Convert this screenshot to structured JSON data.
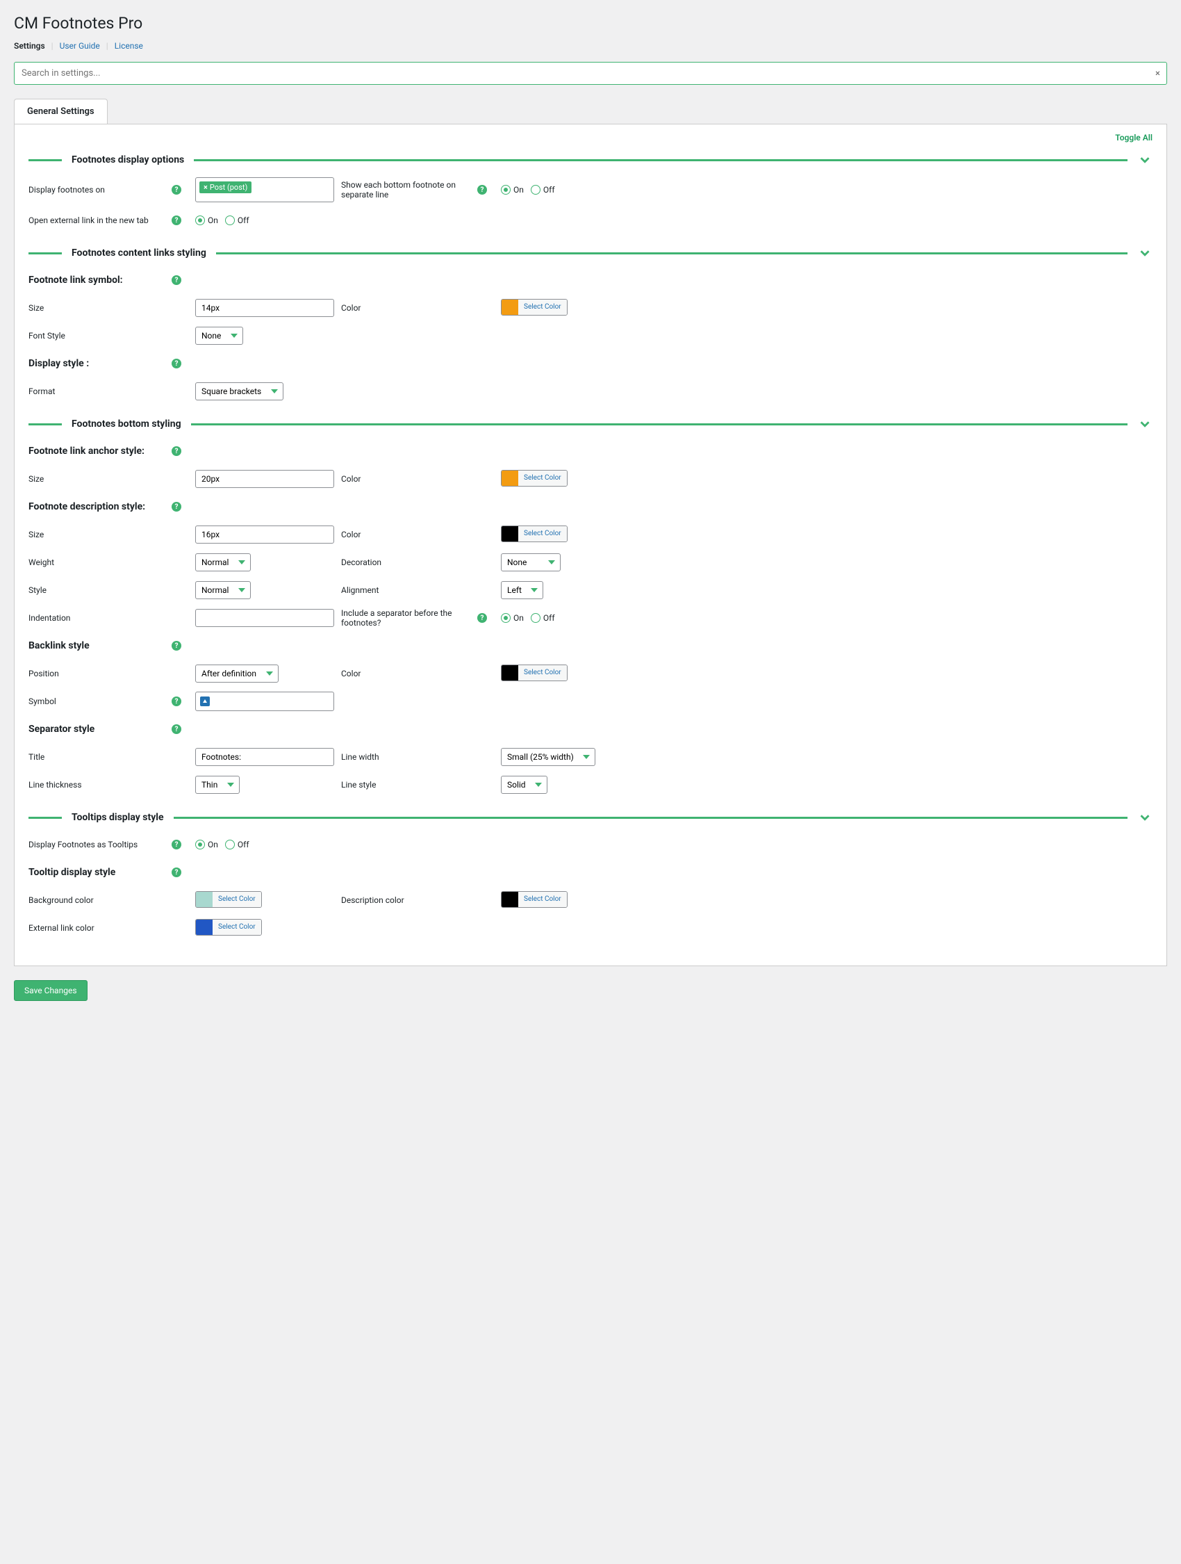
{
  "page_title": "CM Footnotes Pro",
  "nav": {
    "settings": "Settings",
    "user_guide": "User Guide",
    "license": "License"
  },
  "search": {
    "placeholder": "Search in settings...",
    "clear": "×"
  },
  "tab": "General Settings",
  "toggle_all": "Toggle All",
  "labels": {
    "on": "On",
    "off": "Off",
    "select_color": "Select Color"
  },
  "sections": {
    "display_options": {
      "title": "Footnotes display options",
      "display_on_label": "Display footnotes on",
      "display_on_tag": "Post (post)",
      "separate_line_label": "Show each bottom footnote on separate line",
      "external_link_label": "Open external link in the new tab"
    },
    "content_links": {
      "title": "Footnotes content links styling",
      "symbol_heading": "Footnote link symbol:",
      "size_label": "Size",
      "size_value": "14px",
      "color_label": "Color",
      "color_value": "#f39c12",
      "font_style_label": "Font Style",
      "font_style_value": "None",
      "display_style_heading": "Display style :",
      "format_label": "Format",
      "format_value": "Square brackets"
    },
    "bottom_styling": {
      "title": "Footnotes bottom styling",
      "anchor_heading": "Footnote link anchor style:",
      "anchor_size_label": "Size",
      "anchor_size_value": "20px",
      "anchor_color_label": "Color",
      "anchor_color_value": "#f39c12",
      "desc_heading": "Footnote description style:",
      "desc_size_label": "Size",
      "desc_size_value": "16px",
      "desc_color_label": "Color",
      "desc_color_value": "#000000",
      "weight_label": "Weight",
      "weight_value": "Normal",
      "decoration_label": "Decoration",
      "decoration_value": "None",
      "style_label": "Style",
      "style_value": "Normal",
      "alignment_label": "Alignment",
      "alignment_value": "Left",
      "indentation_label": "Indentation",
      "indentation_value": "",
      "separator_label": "Include a separator before the footnotes?",
      "backlink_heading": "Backlink style",
      "position_label": "Position",
      "position_value": "After definition",
      "backlink_color_label": "Color",
      "backlink_color_value": "#000000",
      "symbol_label": "Symbol",
      "separator_heading": "Separator style",
      "title_label": "Title",
      "title_value": "Footnotes:",
      "line_width_label": "Line width",
      "line_width_value": "Small (25% width)",
      "line_thickness_label": "Line thickness",
      "line_thickness_value": "Thin",
      "line_style_label": "Line style",
      "line_style_value": "Solid"
    },
    "tooltips": {
      "title": "Tooltips display style",
      "display_tooltips_label": "Display Footnotes as Tooltips",
      "tooltip_style_heading": "Tooltip display style",
      "bg_color_label": "Background color",
      "bg_color_value": "#a8d8cf",
      "desc_color_label": "Description color",
      "desc_color_value": "#000000",
      "ext_link_color_label": "External link color",
      "ext_link_color_value": "#2157c4"
    }
  },
  "save": "Save Changes"
}
